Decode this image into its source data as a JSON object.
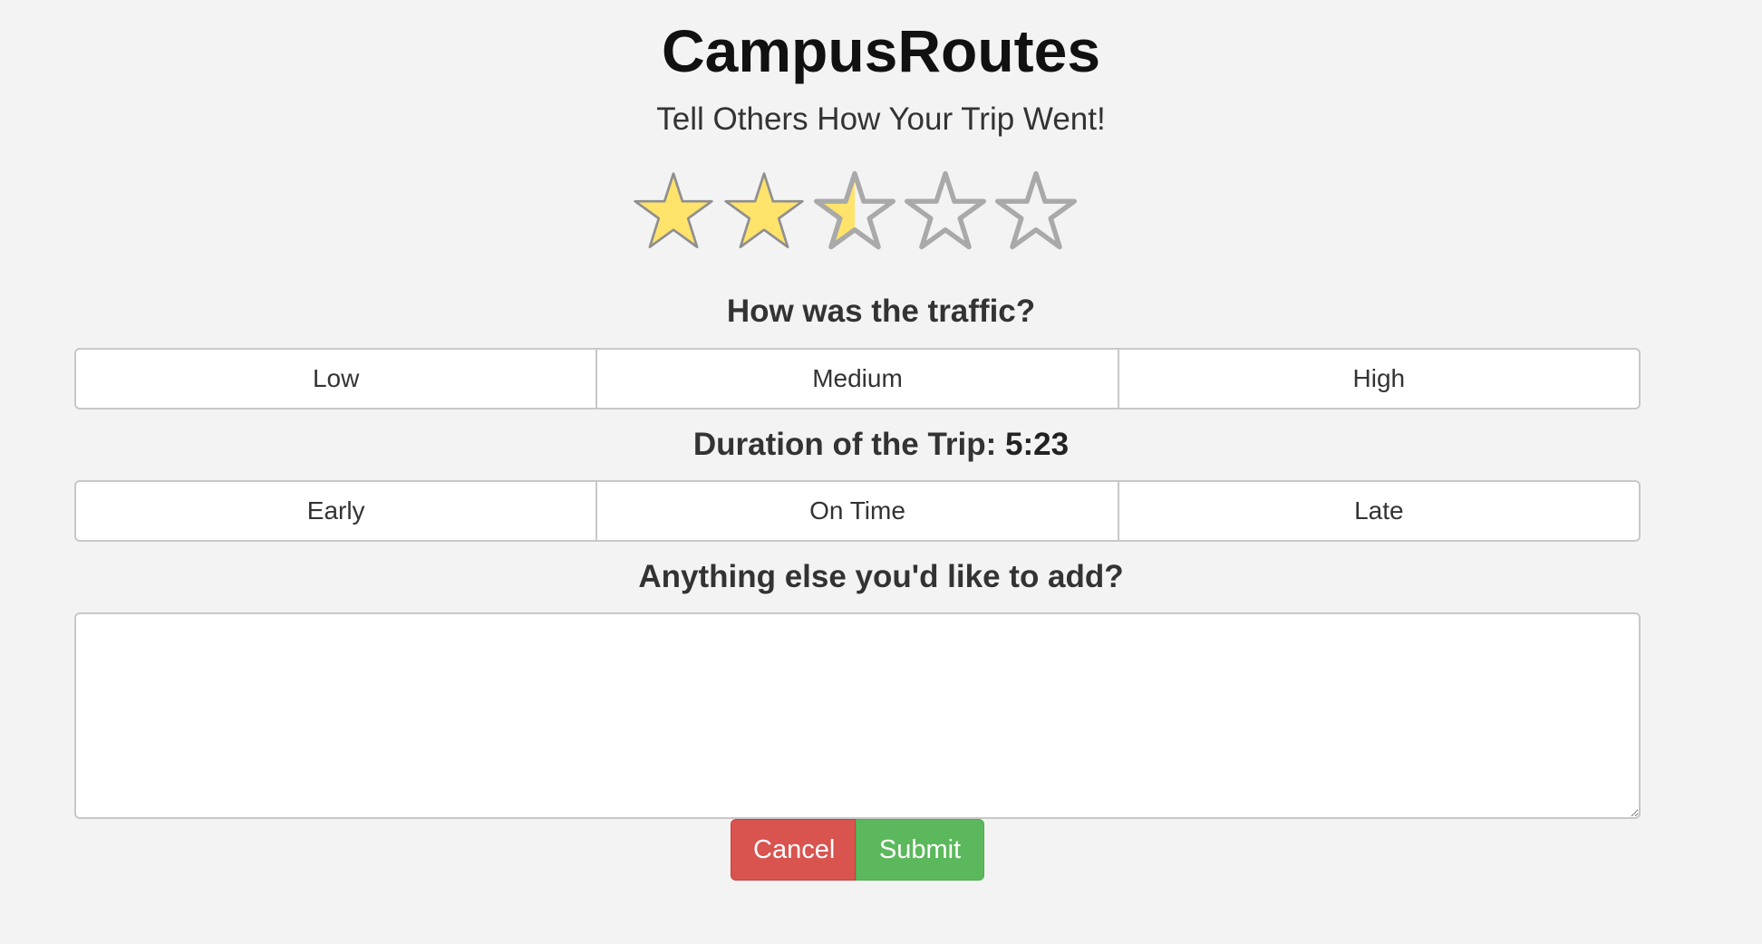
{
  "header": {
    "title": "CampusRoutes",
    "subtitle": "Tell Others How Your Trip Went!"
  },
  "rating": {
    "value": 2.5,
    "max": 5,
    "filled_color": "#ffe36b",
    "empty_color": "#a9a9a9"
  },
  "traffic": {
    "question": "How was the traffic?",
    "options": [
      "Low",
      "Medium",
      "High"
    ]
  },
  "duration": {
    "label": "Duration of the Trip:",
    "value": "5:23",
    "options": [
      "Early",
      "On Time",
      "Late"
    ]
  },
  "notes": {
    "question": "Anything else you'd like to add?",
    "value": ""
  },
  "actions": {
    "cancel_label": "Cancel",
    "submit_label": "Submit",
    "cancel_color": "#d9534f",
    "submit_color": "#5cb85c"
  }
}
